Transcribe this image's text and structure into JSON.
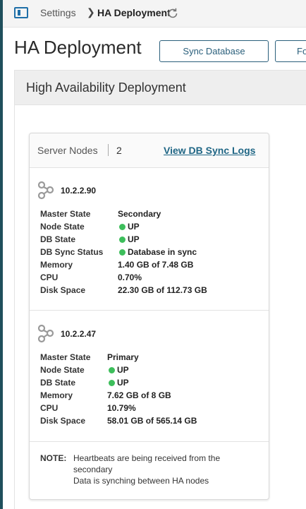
{
  "breadcrumb": {
    "parent": "Settings",
    "current": "HA Deployment"
  },
  "page": {
    "title": "HA Deployment"
  },
  "toolbar": {
    "sync_label": "Sync Database",
    "fo_label": "Fo"
  },
  "section": {
    "title": "High Availability Deployment"
  },
  "nodes_card": {
    "label": "Server Nodes",
    "count": "2",
    "sync_logs_link": "View DB Sync Logs"
  },
  "nodes": [
    {
      "ip": "10.2.2.90",
      "master_state_label": "Master State",
      "master_state": "Secondary",
      "node_state_label": "Node State",
      "node_state": "UP",
      "db_state_label": "DB State",
      "db_state": "UP",
      "db_sync_label": "DB Sync Status",
      "db_sync": "Database in sync",
      "memory_label": "Memory",
      "memory": "1.40 GB of 7.48 GB",
      "cpu_label": "CPU",
      "cpu": "0.70%",
      "disk_label": "Disk Space",
      "disk": "22.30 GB of 112.73 GB"
    },
    {
      "ip": "10.2.2.47",
      "master_state_label": "Master State",
      "master_state": "Primary",
      "node_state_label": "Node State",
      "node_state": "UP",
      "db_state_label": "DB State",
      "db_state": "UP",
      "memory_label": "Memory",
      "memory": "7.62 GB of 8 GB",
      "cpu_label": "CPU",
      "cpu": "10.79%",
      "disk_label": "Disk Space",
      "disk": "58.01 GB of 565.14 GB"
    }
  ],
  "note": {
    "label": "NOTE:",
    "line1": "Heartbeats are being received from the secondary",
    "line2": "Data is synching between HA nodes"
  },
  "colors": {
    "accent": "#1f6685",
    "status_up": "#3dbe5b",
    "sidebar": "#1f4f5c"
  },
  "icons": {
    "panel": "sidebar-panel-icon",
    "refresh": "refresh-icon",
    "node": "share-nodes-icon"
  }
}
